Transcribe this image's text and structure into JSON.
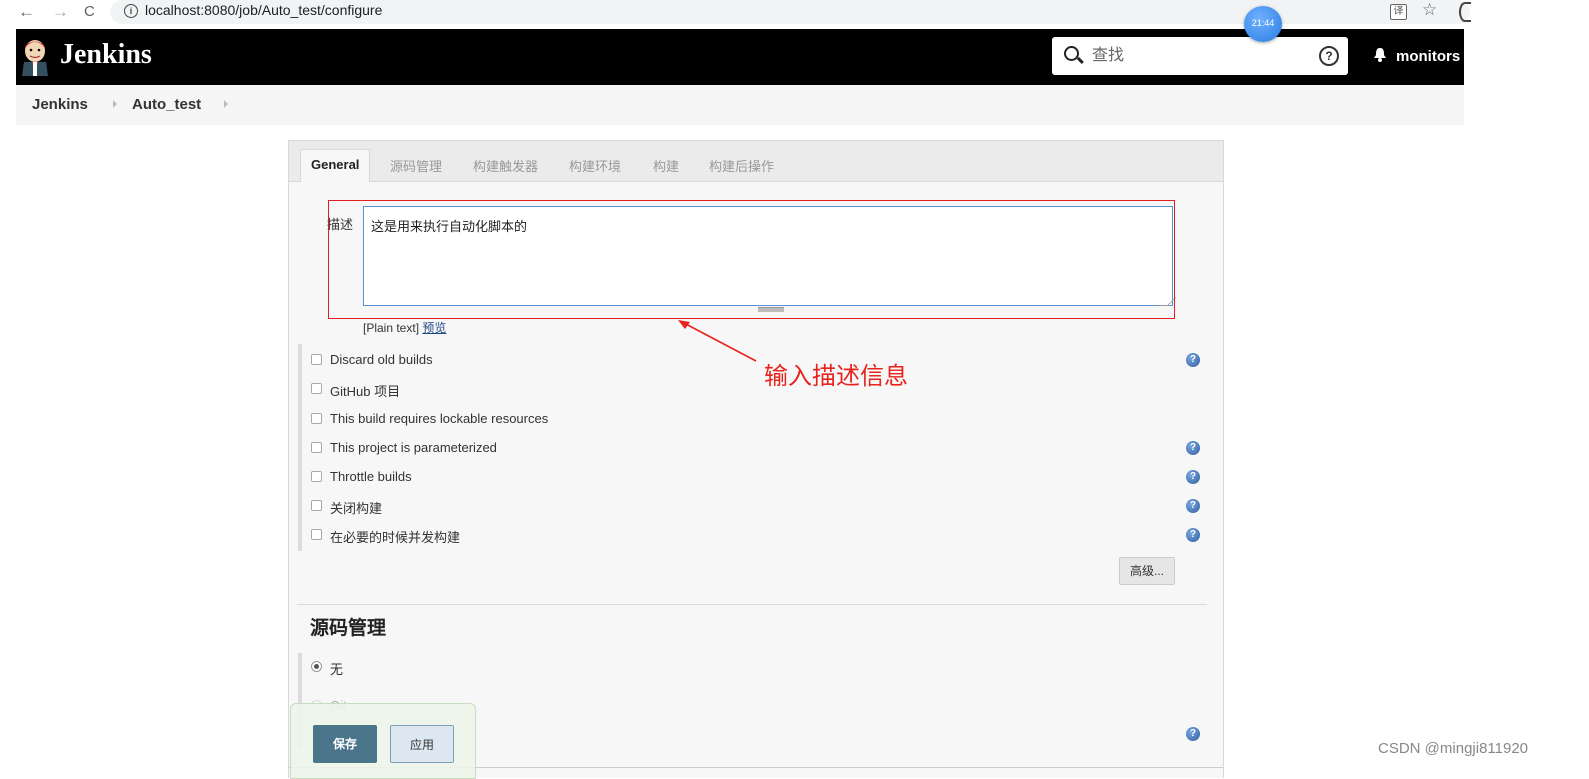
{
  "browser": {
    "url": "localhost:8080/job/Auto_test/configure",
    "clock": "21:44"
  },
  "header": {
    "brand": "Jenkins",
    "search_placeholder": "查找",
    "help_glyph": "?",
    "user": "monitors"
  },
  "breadcrumb": [
    "Jenkins",
    "Auto_test"
  ],
  "tabs": [
    "General",
    "源码管理",
    "构建触发器",
    "构建环境",
    "构建",
    "构建后操作"
  ],
  "general": {
    "desc_label": "描述",
    "desc_value": "这是用来执行自动化脚本的",
    "plain_text": "[Plain text]",
    "preview_link": "预览",
    "options": [
      {
        "label": "Discard old builds",
        "help": true
      },
      {
        "label": "GitHub 项目",
        "help": false
      },
      {
        "label": "This build requires lockable resources",
        "help": false
      },
      {
        "label": "This project is parameterized",
        "help": true
      },
      {
        "label": "Throttle builds",
        "help": true
      },
      {
        "label": "关闭构建",
        "help": true
      },
      {
        "label": "在必要的时候并发构建",
        "help": true
      }
    ],
    "advanced_button": "高级..."
  },
  "scm": {
    "title": "源码管理",
    "options": [
      "无",
      "Git"
    ]
  },
  "actions": {
    "save": "保存",
    "apply": "应用"
  },
  "annotation": {
    "text": "输入描述信息",
    "color": "#e8231e"
  },
  "watermark": "CSDN @mingji811920"
}
